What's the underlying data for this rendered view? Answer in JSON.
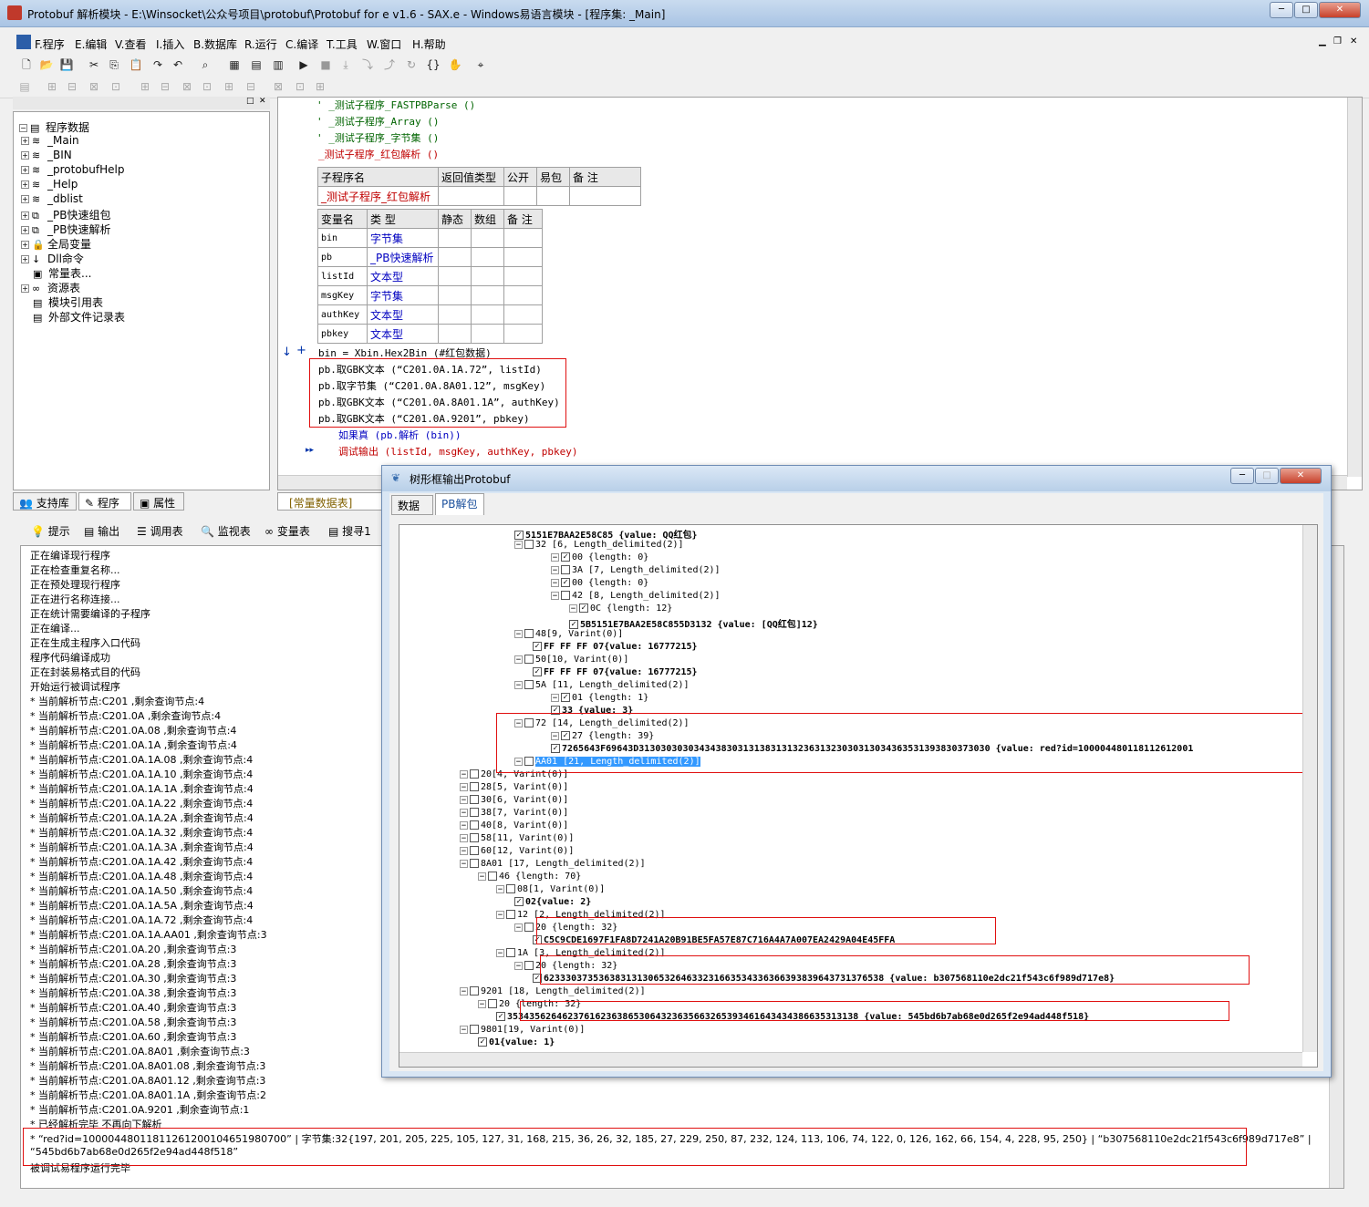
{
  "window": {
    "title": "Protobuf 解析模块 - E:\\Winsocket\\公众号项目\\protobuf\\Protobuf for e v1.6 - SAX.e - Windows易语言模块 - [程序集: _Main]",
    "minimize": "─",
    "maximize": "□",
    "close": "✕"
  },
  "menu": [
    "F.程序",
    "E.编辑",
    "V.查看",
    "I.插入",
    "B.数据库",
    "R.运行",
    "C.编译",
    "T.工具",
    "W.窗口",
    "H.帮助"
  ],
  "tree": {
    "root": "程序数据",
    "items": [
      "_Main",
      "_BIN",
      "_protobufHelp",
      "_Help",
      "_dblist",
      "_PB快速组包",
      "_PB快速解析",
      "全局变量",
      "Dll命令",
      "常量表...",
      "资源表",
      "模块引用表",
      "外部文件记录表"
    ]
  },
  "left_tabs": [
    "支持库",
    "程序",
    "属性"
  ],
  "code_tabs": [
    "[常量数据表]"
  ],
  "code": {
    "comments": [
      "' _测试子程序_FASTPBParse ()",
      "' _测试子程序_Array ()",
      "' _测试子程序_字节集 ()"
    ],
    "sub_call": "_测试子程序_红包解析 ()",
    "sub_header": [
      "子程序名",
      "返回值类型",
      "公开",
      "易包",
      "备 注"
    ],
    "sub_name": "_测试子程序_红包解析",
    "var_header": [
      "变量名",
      "类 型",
      "静态",
      "数组",
      "备 注"
    ],
    "vars": [
      [
        "bin",
        "字节集"
      ],
      [
        "pb",
        "_PB快速解析"
      ],
      [
        "listId",
        "文本型"
      ],
      [
        "msgKey",
        "字节集"
      ],
      [
        "authKey",
        "文本型"
      ],
      [
        "pbkey",
        "文本型"
      ]
    ],
    "lines": [
      "bin = Xbin.Hex2Bin (#红包数据)",
      "pb.取GBK文本 (“C201.0A.1A.72”, listId)",
      "pb.取字节集 (“C201.0A.8A01.12”, msgKey)",
      "pb.取GBK文本 (“C201.0A.8A01.1A”, authKey)",
      "pb.取GBK文本 (“C201.0A.9201”, pbkey)",
      "如果真 (pb.解析 (bin))",
      "调试输出 (listId, msgKey, authKey, pbkey)"
    ]
  },
  "bottom_tabs": [
    "提示",
    "输出",
    "调用表",
    "监视表",
    "变量表",
    "搜寻1"
  ],
  "output": [
    "正在编译现行程序",
    "正在检查重复名称...",
    "正在预处理现行程序",
    "正在进行名称连接...",
    "正在统计需要编译的子程序",
    "正在编译...",
    "正在生成主程序入口代码",
    "程序代码编译成功",
    "正在封装易格式目的代码",
    "开始运行被调试程序",
    "* 当前解析节点:C201              ,剩余查询节点:4",
    "* 当前解析节点:C201.0A           ,剩余查询节点:4",
    "* 当前解析节点:C201.0A.08               ,剩余查询节点:4",
    "* 当前解析节点:C201.0A.1A               ,剩余查询节点:4",
    "* 当前解析节点:C201.0A.1A.08            ,剩余查询节点:4",
    "* 当前解析节点:C201.0A.1A.10            ,剩余查询节点:4",
    "* 当前解析节点:C201.0A.1A.1A            ,剩余查询节点:4",
    "* 当前解析节点:C201.0A.1A.22            ,剩余查询节点:4",
    "* 当前解析节点:C201.0A.1A.2A            ,剩余查询节点:4",
    "* 当前解析节点:C201.0A.1A.32            ,剩余查询节点:4",
    "* 当前解析节点:C201.0A.1A.3A            ,剩余查询节点:4",
    "* 当前解析节点:C201.0A.1A.42            ,剩余查询节点:4",
    "* 当前解析节点:C201.0A.1A.48            ,剩余查询节点:4",
    "* 当前解析节点:C201.0A.1A.50            ,剩余查询节点:4",
    "* 当前解析节点:C201.0A.1A.5A            ,剩余查询节点:4",
    "* 当前解析节点:C201.0A.1A.72            ,剩余查询节点:4",
    "* 当前解析节点:C201.0A.1A.AA01          ,剩余查询节点:3",
    "* 当前解析节点:C201.0A.20               ,剩余查询节点:3",
    "* 当前解析节点:C201.0A.28               ,剩余查询节点:3",
    "* 当前解析节点:C201.0A.30               ,剩余查询节点:3",
    "* 当前解析节点:C201.0A.38               ,剩余查询节点:3",
    "* 当前解析节点:C201.0A.40               ,剩余查询节点:3",
    "* 当前解析节点:C201.0A.58               ,剩余查询节点:3",
    "* 当前解析节点:C201.0A.60               ,剩余查询节点:3",
    "* 当前解析节点:C201.0A.8A01             ,剩余查询节点:3",
    "* 当前解析节点:C201.0A.8A01.08          ,剩余查询节点:3",
    "* 当前解析节点:C201.0A.8A01.12          ,剩余查询节点:3",
    "* 当前解析节点:C201.0A.8A01.1A          ,剩余查询节点:2",
    "* 当前解析节点:C201.0A.9201             ,剩余查询节点:1",
    "* 已经解析完毕 不再向下解析",
    "* “red?id=10000448011811261200104651980700” | 字节集:32{197, 201, 205, 225, 105, 127, 31, 168, 215, 36, 26, 32, 185, 27, 229, 250, 87, 232, 124, 113, 106, 74, 122, 0, 126, 162, 66, 154, 4, 228, 95, 250} | “b307568110e2dc21f543c6f989d717e8” |",
    "“545bd6b7ab68e0d265f2e94ad448f518”",
    "被调试易程序运行完毕"
  ],
  "dialog": {
    "title": "树形框输出Protobuf",
    "tabs": [
      "数据",
      "PB解包"
    ],
    "rows": [
      {
        "t": "5151E7BAA2E58C85 {value: QQ红包}",
        "b": true
      },
      {
        "t": "32 [6, Length_delimited(2)]"
      },
      {
        "t": "00 {length: 0}"
      },
      {
        "t": "3A [7, Length_delimited(2)]"
      },
      {
        "t": "00 {length: 0}"
      },
      {
        "t": "42 [8, Length_delimited(2)]"
      },
      {
        "t": "0C {length: 12}"
      },
      {
        "t": "5B5151E7BAA2E58C855D3132 {value: [QQ红包]12}",
        "b": true
      },
      {
        "t": "48[9, Varint(0)]"
      },
      {
        "t": "FF FF FF 07{value: 16777215}",
        "b": true
      },
      {
        "t": "50[10, Varint(0)]"
      },
      {
        "t": "FF FF FF 07{value: 16777215}",
        "b": true
      },
      {
        "t": "5A [11, Length_delimited(2)]"
      },
      {
        "t": "01 {length: 1}"
      },
      {
        "t": "33 {value: 3}",
        "b": true
      },
      {
        "t": "72 [14, Length_delimited(2)]"
      },
      {
        "t": "27 {length: 39}"
      },
      {
        "t": "7265643F69643D3130303030343438303131383131323631323030313034363531393830373030 {value: red?id=100004480118112612001",
        "b": true
      },
      {
        "t": "AA01 [21, Length_delimited(2)]"
      },
      {
        "t": "20[4, Varint(0)]"
      },
      {
        "t": "28[5, Varint(0)]"
      },
      {
        "t": "30[6, Varint(0)]"
      },
      {
        "t": "38[7, Varint(0)]"
      },
      {
        "t": "40[8, Varint(0)]"
      },
      {
        "t": "58[11, Varint(0)]"
      },
      {
        "t": "60[12, Varint(0)]"
      },
      {
        "t": "8A01 [17, Length_delimited(2)]"
      },
      {
        "t": "46 {length: 70}"
      },
      {
        "t": "08[1, Varint(0)]"
      },
      {
        "t": "02{value: 2}",
        "b": true
      },
      {
        "t": "12 [2, Length_delimited(2)]"
      },
      {
        "t": "20 {length: 32}"
      },
      {
        "t": "C5C9CDE1697F1FA8D7241A20B91BE5FA57E87C716A4A7A007EA2429A04E45FFA",
        "b": true
      },
      {
        "t": "1A [3, Length_delimited(2)]"
      },
      {
        "t": "20 {length: 32}"
      },
      {
        "t": "62333037353638313130653264633231663534336366393839643731376538 {value: b307568110e2dc21f543c6f989d717e8}",
        "b": true
      },
      {
        "t": "9201 [18, Length_delimited(2)]"
      },
      {
        "t": "20 {length: 32}"
      },
      {
        "t": "3534356264623761623638653064323635663265393461643434386635313138 {value: 545bd6b7ab68e0d265f2e94ad448f518}",
        "b": true
      },
      {
        "t": "9801[19, Varint(0)]"
      },
      {
        "t": "01{value: 1}",
        "b": true
      }
    ]
  }
}
